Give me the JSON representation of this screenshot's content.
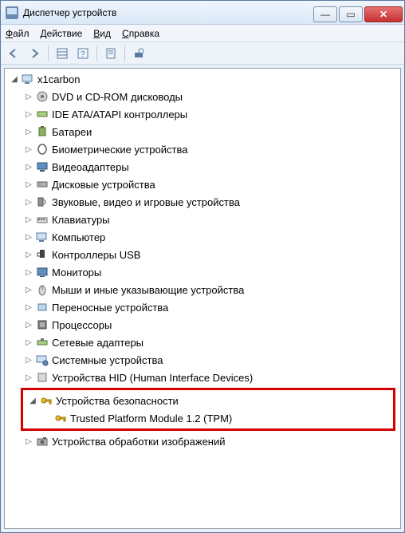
{
  "window": {
    "title": "Диспетчер устройств"
  },
  "menu": {
    "file": "Файл",
    "action": "Действие",
    "view": "Вид",
    "help": "Справка"
  },
  "root": {
    "name": "x1carbon"
  },
  "categories": [
    {
      "label": "DVD и CD-ROM дисководы"
    },
    {
      "label": "IDE ATA/ATAPI контроллеры"
    },
    {
      "label": "Батареи"
    },
    {
      "label": "Биометрические устройства"
    },
    {
      "label": "Видеоадаптеры"
    },
    {
      "label": "Дисковые устройства"
    },
    {
      "label": "Звуковые, видео и игровые устройства"
    },
    {
      "label": "Клавиатуры"
    },
    {
      "label": "Компьютер"
    },
    {
      "label": "Контроллеры USB"
    },
    {
      "label": "Мониторы"
    },
    {
      "label": "Мыши и иные указывающие устройства"
    },
    {
      "label": "Переносные устройства"
    },
    {
      "label": "Процессоры"
    },
    {
      "label": "Сетевые адаптеры"
    },
    {
      "label": "Системные устройства"
    },
    {
      "label": "Устройства HID (Human Interface Devices)"
    }
  ],
  "security": {
    "label": "Устройства безопасности",
    "child": "Trusted Platform Module 1.2 (TPM)"
  },
  "after": [
    {
      "label": "Устройства обработки изображений"
    }
  ]
}
